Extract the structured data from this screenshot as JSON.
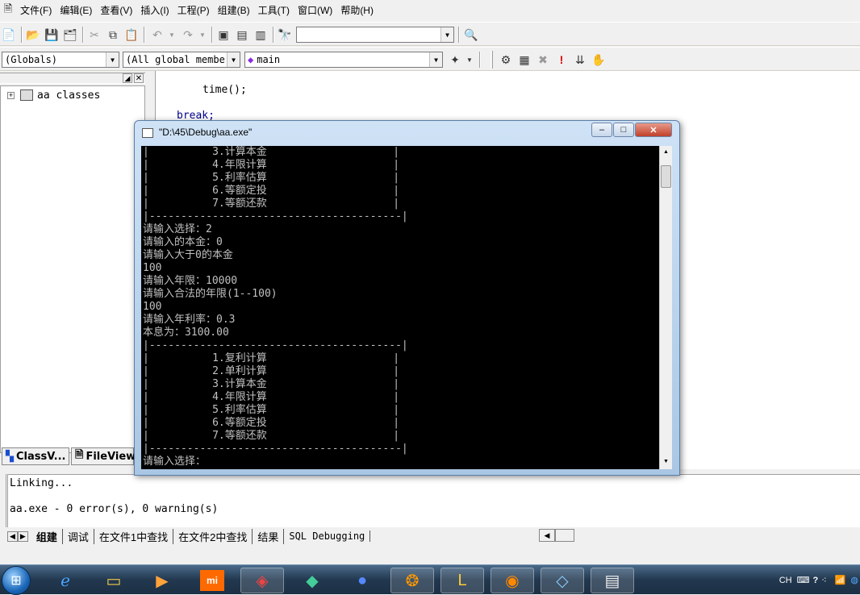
{
  "menubar": {
    "items": [
      "文件(F)",
      "编辑(E)",
      "查看(V)",
      "插入(I)",
      "工程(P)",
      "组建(B)",
      "工具(T)",
      "窗口(W)",
      "帮助(H)"
    ]
  },
  "toolbar": {
    "find_combo_value": ""
  },
  "wizardbar": {
    "scope": "(Globals)",
    "members": "(All global members",
    "function": "main"
  },
  "workspace": {
    "tree_root": "aa classes",
    "tabs": [
      "ClassV...",
      "FileView"
    ]
  },
  "editor": {
    "lines": [
      "time();",
      "break;"
    ]
  },
  "output": {
    "lines": [
      "Linking...",
      "",
      "aa.exe - 0 error(s), 0 warning(s)"
    ],
    "tabs": [
      "组建",
      "调试",
      "在文件1中查找",
      "在文件2中查找",
      "结果",
      "SQL Debugging"
    ]
  },
  "console": {
    "title": "\"D:\\45\\Debug\\aa.exe\"",
    "lines": [
      "|          3.计算本金                    |",
      "|          4.年限计算                    |",
      "|          5.利率估算                    |",
      "|          6.等额定投                    |",
      "|          7.等额还款                    |",
      "|----------------------------------------|",
      "请输入选择：2",
      "请输入的本金：0",
      "请输入大于0的本金",
      "100",
      "请输入年限：10000",
      "请输入合法的年限(1--100)",
      "100",
      "请输入年利率：0.3",
      "本息为：3100.00",
      "|----------------------------------------|",
      "|          1.复利计算                    |",
      "|          2.单利计算                    |",
      "|          3.计算本金                    |",
      "|          4.年限计算                    |",
      "|          5.利率估算                    |",
      "|          6.等额定投                    |",
      "|          7.等额还款                    |",
      "|----------------------------------------|",
      "请输入选择："
    ]
  },
  "taskbar": {
    "tray_lang": "CH",
    "apps": [
      "ie-icon",
      "explorer-icon",
      "media-player-icon",
      "mi-icon",
      "app5-icon",
      "app6-icon",
      "eclipse-icon",
      "app8-icon",
      "lol-icon",
      "app10-icon",
      "app11-icon",
      "vc-icon"
    ]
  },
  "colors": {
    "console_bg": "#000000",
    "console_fg": "#c0c0c0",
    "keyword": "#00008b",
    "taskbar": "#22384f"
  }
}
